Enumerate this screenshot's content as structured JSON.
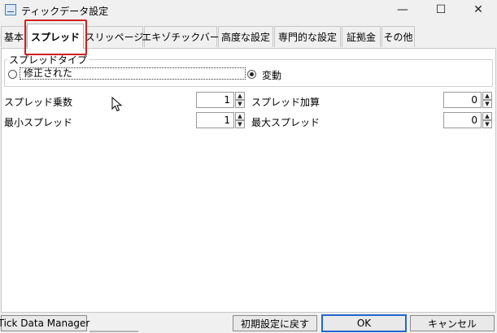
{
  "window": {
    "title": "ティックデータ設定",
    "icon": "tick-chart-icon",
    "controls": {
      "minimize": "—",
      "maximize": "☐",
      "close": "✕"
    }
  },
  "tabs": [
    {
      "label": "基本",
      "active": false
    },
    {
      "label": "スプレッド",
      "active": true
    },
    {
      "label": "スリッページ",
      "active": false
    },
    {
      "label": "エキゾチックバー",
      "active": false
    },
    {
      "label": "高度な設定",
      "active": false
    },
    {
      "label": "専門的な設定",
      "active": false
    },
    {
      "label": "証拠金",
      "active": false
    },
    {
      "label": "その他",
      "active": false
    }
  ],
  "spread_type": {
    "title": "スプレッドタイプ",
    "options": [
      {
        "label": "修正された",
        "selected": false
      },
      {
        "label": "変動",
        "selected": true
      }
    ]
  },
  "fields": {
    "spread_multiplier": {
      "label": "スプレッド乗数",
      "value": "1"
    },
    "spread_addition": {
      "label": "スプレッド加算",
      "value": "0"
    },
    "min_spread": {
      "label": "最小スプレッド",
      "value": "1"
    },
    "max_spread": {
      "label": "最大スプレッド",
      "value": "0"
    }
  },
  "footer": {
    "app_name": "Tick Data Manager",
    "reset_label": "初期設定に戻す",
    "ok_label": "OK",
    "cancel_label": "キャンセル"
  },
  "colors": {
    "highlight": "#d21f1f",
    "ok_border": "#2266cc"
  }
}
